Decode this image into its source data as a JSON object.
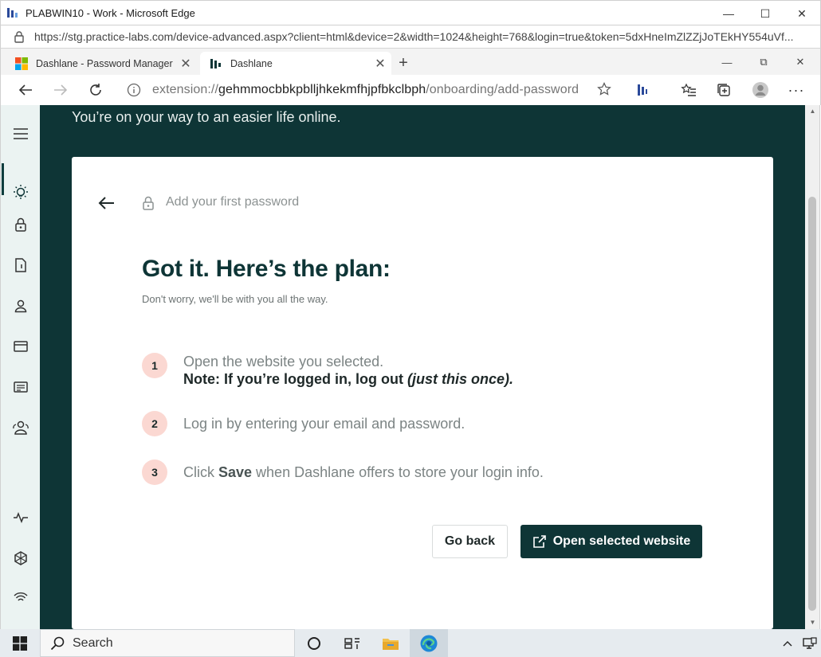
{
  "outer_window": {
    "title": "PLABWIN10 - Work - Microsoft Edge",
    "url": "https://stg.practice-labs.com/device-advanced.aspx?client=html&device=2&width=1024&height=768&login=true&token=5dxHneImZlZZjJoTEkHY554uVf..."
  },
  "browser": {
    "tabs": [
      {
        "label": "Dashlane - Password Manager -"
      },
      {
        "label": "Dashlane"
      }
    ],
    "address": {
      "scheme": "extension://",
      "host": "gehmmocbbkpblljhkekmfhjpfbkclbph",
      "path": "/onboarding/add-password"
    }
  },
  "page": {
    "tagline": "You’re on your way to an easier life online.",
    "breadcrumb": "Add your first password",
    "heading": "Got it. Here’s the plan:",
    "subheading": "Don't worry, we'll be with you all the way.",
    "steps": [
      {
        "num": "1",
        "line1": "Open the website you selected.",
        "note_prefix": "Note: If you’re logged in, log out ",
        "note_em": "(just this once)."
      },
      {
        "num": "2",
        "text": "Log in by entering your email and password."
      },
      {
        "num": "3",
        "pre": "Click ",
        "bold": "Save",
        "post": " when Dashlane offers to store your login info."
      }
    ],
    "buttons": {
      "back": "Go back",
      "open": "Open selected website"
    }
  },
  "taskbar": {
    "search_label": "Search"
  },
  "colors": {
    "brand_dark": "#0e3536",
    "step_badge": "#fbd8d2",
    "sidebar_bg": "#ebf3f2"
  }
}
